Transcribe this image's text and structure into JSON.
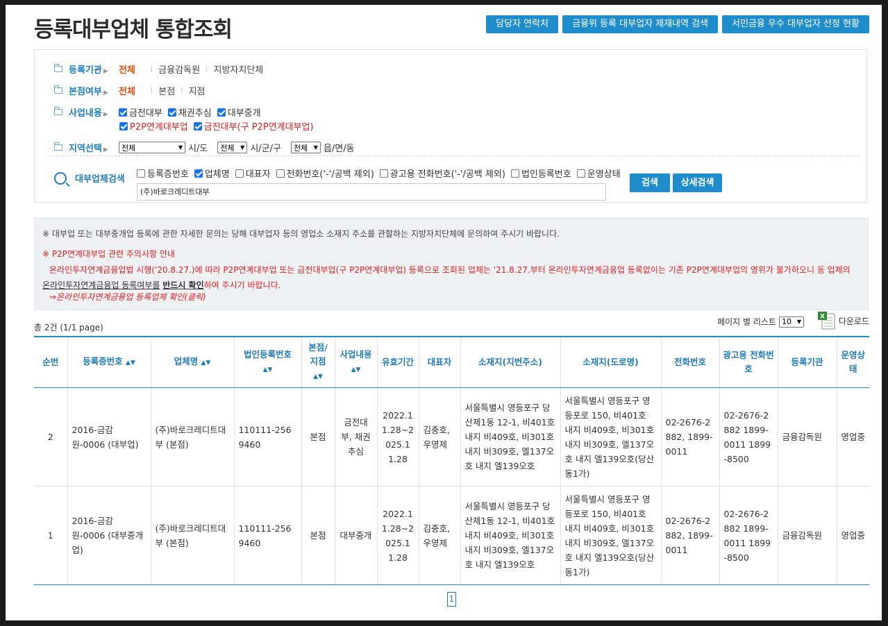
{
  "page_title": "등록대부업체 통합조회",
  "top_buttons": [
    "담당자 연락처",
    "금융위 등록 대부업자 제재내역 검색",
    "서민금융 우수 대부업자 선정 현황"
  ],
  "filters": {
    "org": {
      "label": "등록기관",
      "selected": "전체",
      "options": [
        "금융감독원",
        "지방자치단체"
      ]
    },
    "branch": {
      "label": "본점여부",
      "selected": "전체",
      "options": [
        "본점",
        "지점"
      ]
    },
    "business": {
      "label": "사업내용",
      "checks": [
        {
          "label": "금전대부",
          "checked": true
        },
        {
          "label": "채권추심",
          "checked": true
        },
        {
          "label": "대부중개",
          "checked": true
        }
      ],
      "checks2": [
        {
          "label": "P2P연계대부업",
          "checked": true
        },
        {
          "label": "금전대부(구 P2P연계대부업)",
          "checked": true
        }
      ]
    },
    "region": {
      "label": "지역선택",
      "sido": "전체",
      "sido_unit": "시/도",
      "sigungu": "전체",
      "sigungu_unit": "시/군/구",
      "dong": "전체",
      "dong_unit": "읍/면/동"
    }
  },
  "search": {
    "label": "대부업체검색",
    "checks": [
      {
        "label": "등록증번호",
        "checked": false
      },
      {
        "label": "업체명",
        "checked": true
      },
      {
        "label": "대표자",
        "checked": false
      },
      {
        "label": "전화번호('-'/공백 제외)",
        "checked": false
      },
      {
        "label": "광고용 전화번호('-'/공백 제외)",
        "checked": false
      },
      {
        "label": "법인등록번호",
        "checked": false
      },
      {
        "label": "운영상태",
        "checked": false
      }
    ],
    "value": "(주)바로크레디트대부",
    "search_btn": "검색",
    "detail_btn": "상세검색"
  },
  "notice": {
    "line1": "※ 대부업 또는 대부중개업 등록에 관한 자세한 문의는 당해 대부업자 등의 영업소 소재지 주소를 관할하는 지방자치단체에 문의하여 주시기 바랍니다.",
    "line2": "※ P2P연계대부업 관련 주의사항 안내",
    "line3a": "온라인투자연계금융업법 시행('20.8.27.)에 따라 P2P연계대부업 또는 금전대부업(구 P2P연계대부업) 등록으로 조회된 업체는 '21.8.27.부터 온라인투자연계금융업 등록없이는 기존 P2P연계대부업의 영위가 불가하오니 동 업체의 ",
    "line3_link": "온라인투자연계금융업 등록여부를",
    "line3_bold": "반드시 확인",
    "line3b": "하여 주시기 바랍니다.",
    "line4": "⇒온라인투자연계금융업 등록업체 확인(클릭)"
  },
  "summary": {
    "total": "총 2건 (1/1 page)",
    "per_page_label": "페이지 별 리스트",
    "per_page_value": "10",
    "download": "다운로드"
  },
  "table": {
    "headers": [
      "순번",
      "등록증번호",
      "업체명",
      "법인등록번호",
      "본점/지점",
      "사업내용",
      "유효기간",
      "대표자",
      "소재지(지번주소)",
      "소재지(도로명)",
      "전화번호",
      "광고용 전화번호",
      "등록기관",
      "운영상태"
    ],
    "rows": [
      {
        "no": "2",
        "reg": "2016-금감원-0006 (대부업)",
        "name": "(주)바로크레디트대부 (본점)",
        "corp": "110111-2569460",
        "branch": "본점",
        "biz": "금전대부, 채권추심",
        "period": "2022.11.28~2025.11.28",
        "rep": "김충호, 우영제",
        "addr1": "서울특별시 영등포구 당산제1동 12-1, 비401호 내지 비409호, 비301호 내지 비309호, 엘137오호 내지 엘139오호",
        "addr2": "서울특별시 영등포구 영등포로 150, 비401호 내지 비409호, 비301호 내지 비309호, 엘137오호 내지 엘139오호(당산동1가)",
        "tel": "02-2676-2882, 1899-0011",
        "adtel": "02-2676-2882 1899-0011 1899-8500",
        "org": "금융감독원",
        "status": "영업중"
      },
      {
        "no": "1",
        "reg": "2016-금감원-0006 (대부중개업)",
        "name": "(주)바로크레디트대부 (본점)",
        "corp": "110111-2569460",
        "branch": "본점",
        "biz": "대부중개",
        "period": "2022.11.28~2025.11.28",
        "rep": "김충호, 우영제",
        "addr1": "서울특별시 영등포구 당산제1동 12-1, 비401호 내지 비409호, 비301호 내지 비309호, 엘137오호 내지 엘139오호",
        "addr2": "서울특별시 영등포구 영등포로 150, 비401호 내지 비409호, 비301호 내지 비309호, 엘137오호 내지 엘139오호(당산동1가)",
        "tel": "02-2676-2882, 1899-0011",
        "adtel": "02-2676-2882 1899-0011 1899-8500",
        "org": "금융감독원",
        "status": "영업중"
      }
    ]
  },
  "pager": {
    "current": "1"
  },
  "colors": {
    "accent": "#1f8ccc",
    "label_blue": "#1f7bb8",
    "selected_orange": "#d4500f",
    "warning_red": "#e02020"
  }
}
